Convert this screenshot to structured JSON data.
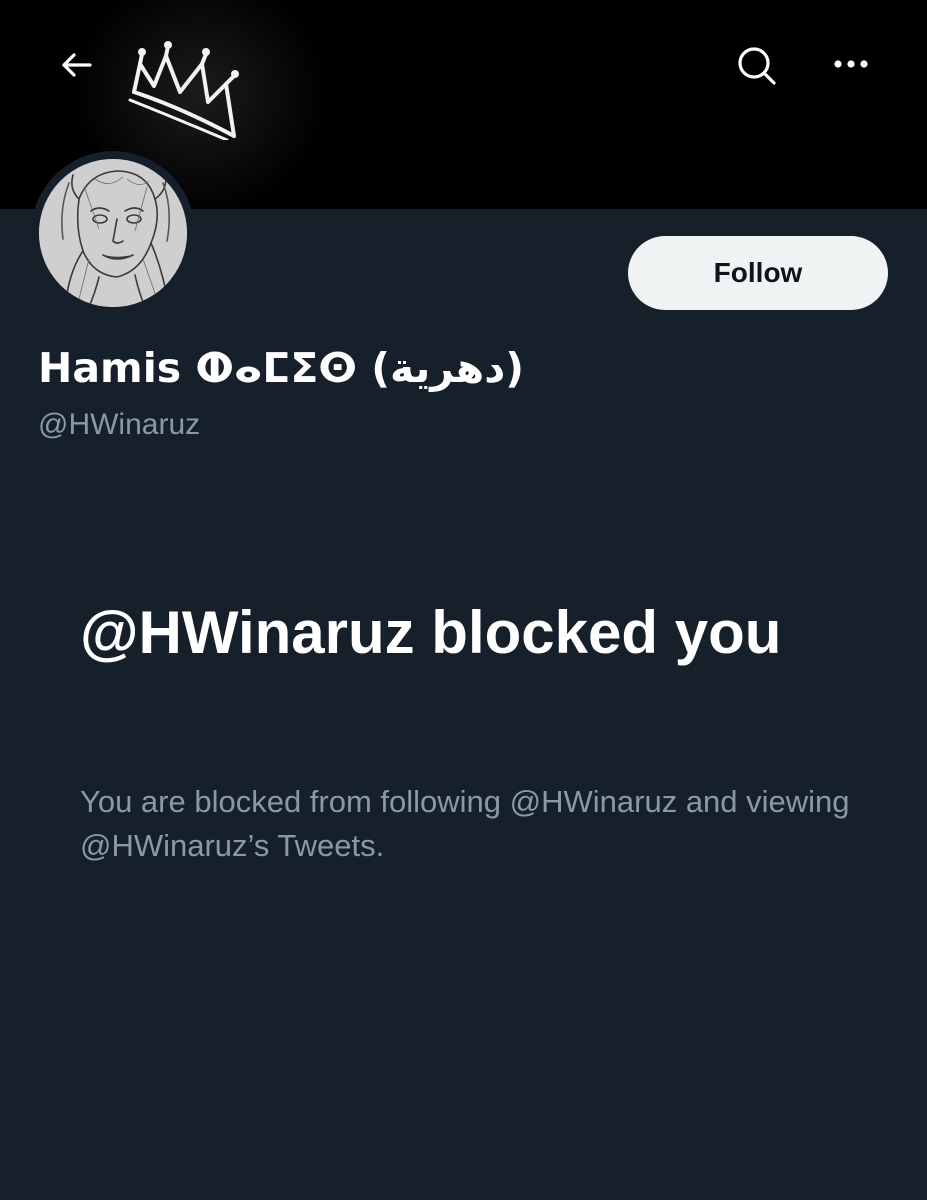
{
  "header": {
    "back_icon": "arrow-left-icon",
    "search_icon": "search-icon",
    "more_icon": "more-horizontal-icon"
  },
  "banner": {
    "graphic": "neon-crown"
  },
  "profile": {
    "display_name": "Hamis ⵀⴰⵎⵉⵙ (دهرية)",
    "handle": "@HWinaruz",
    "follow_label": "Follow"
  },
  "blocked": {
    "title": "@HWinaruz blocked you",
    "message": "You are blocked from following @HWinaruz and viewing @HWinaruz’s Tweets."
  },
  "colors": {
    "background": "#15202b",
    "banner": "#000000",
    "text_primary": "#ffffff",
    "text_secondary": "#8b98a5",
    "follow_button_bg": "#eff3f4",
    "follow_button_text": "#0f1419"
  }
}
